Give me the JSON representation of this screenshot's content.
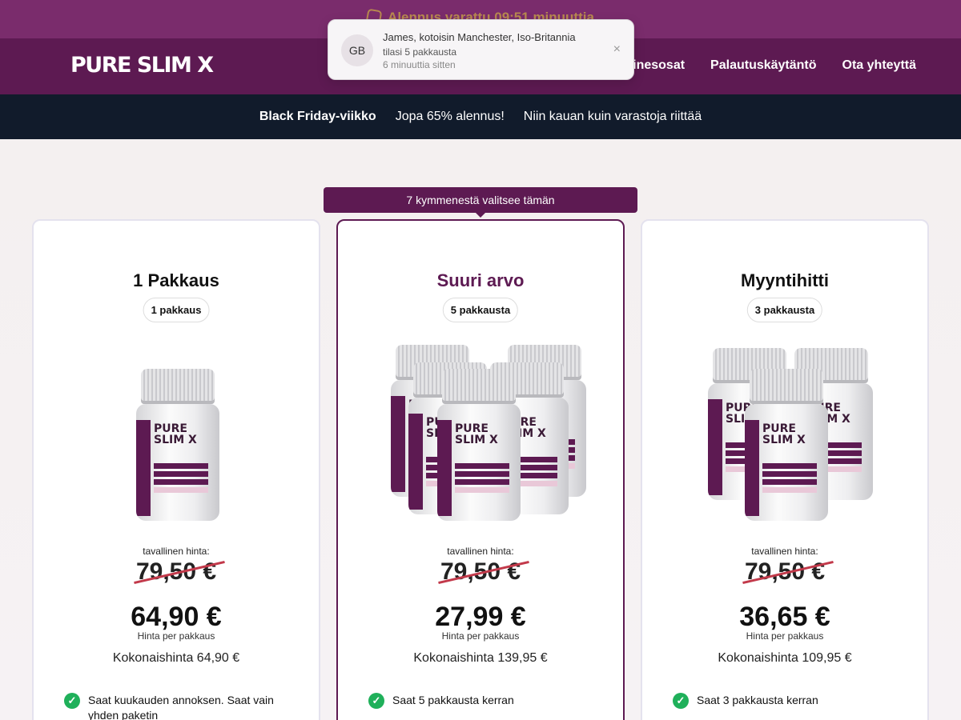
{
  "topbar": {
    "text": "Alennus varattu 09:51 minuuttia"
  },
  "header": {
    "logo": "PURE SLIM X",
    "nav": [
      "Ainesosat",
      "Palautuskäytäntö",
      "Ota yhteyttä"
    ]
  },
  "promo": {
    "items": [
      "Black Friday-viikko",
      "Jopa 65% alennus!",
      "Niin kauan kuin varastoja riittää"
    ]
  },
  "toast": {
    "initials": "GB",
    "line1": "James, kotoisin Manchester, Iso-Britannia",
    "line2": "tilasi 5 pakkausta",
    "line3": "6 minuuttia sitten",
    "close": "×"
  },
  "ribbon": "7 kymmenestä valitsee tämän",
  "bottle_label": "PURE\nSLIM X",
  "cards": [
    {
      "title": "1 Pakkaus",
      "pill": "1 pakkaus",
      "regular_label": "tavallinen hinta:",
      "old_price": "79,50 €",
      "price": "64,90 €",
      "per_label": "Hinta per pakkaus",
      "total": "Kokonaishinta 64,90 €",
      "features": [
        "Saat kuukauden annoksen. Saat vain yhden paketin"
      ]
    },
    {
      "title": "Suuri arvo",
      "pill": "5 pakkausta",
      "regular_label": "tavallinen hinta:",
      "old_price": "79,50 €",
      "price": "27,99 €",
      "per_label": "Hinta per pakkaus",
      "total": "Kokonaishinta 139,95 €",
      "features": [
        "Saat 5 pakkausta kerran"
      ]
    },
    {
      "title": "Myyntihitti",
      "pill": "3 pakkausta",
      "regular_label": "tavallinen hinta:",
      "old_price": "79,50 €",
      "price": "36,65 €",
      "per_label": "Hinta per pakkaus",
      "total": "Kokonaishinta 109,95 €",
      "features": [
        "Saat 3 pakkausta kerran"
      ]
    }
  ],
  "colors": {
    "brand": "#5d1a52",
    "promo_bg": "#111b2b",
    "check": "#1fb05a",
    "strike": "#c2394a"
  }
}
